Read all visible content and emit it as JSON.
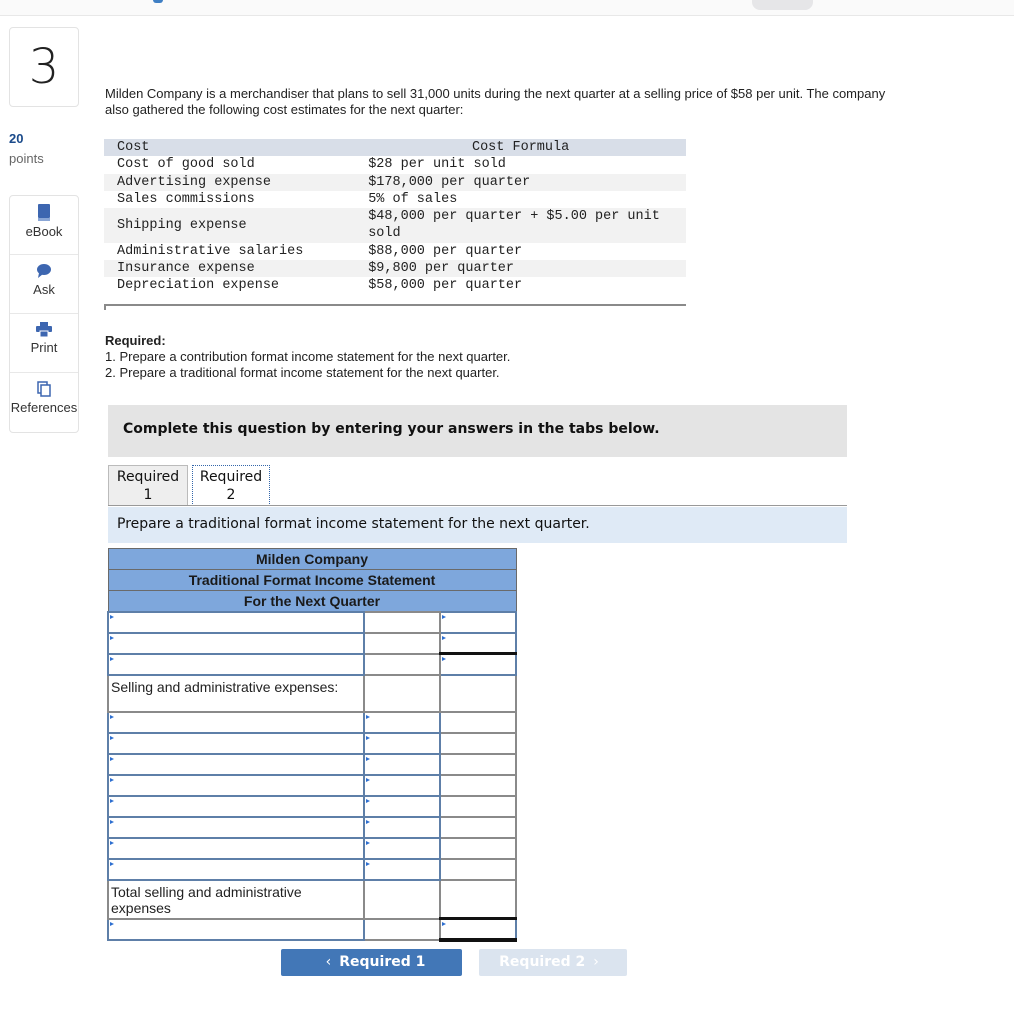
{
  "question": {
    "number": "3",
    "points_value": "20",
    "points_label": "points"
  },
  "tools": [
    {
      "label": "eBook",
      "icon": "book-icon"
    },
    {
      "label": "Ask",
      "icon": "speech-bubble-icon"
    },
    {
      "label": "Print",
      "icon": "printer-icon"
    },
    {
      "label": "References",
      "icon": "documents-icon"
    }
  ],
  "intro_text": "Milden Company is a merchandiser that plans to sell 31,000 units during the next quarter at a selling price of $58 per unit. The company also gathered the following cost estimates for the next quarter:",
  "cost_table": {
    "headers": [
      "Cost",
      "Cost Formula"
    ],
    "rows": [
      {
        "cost": "Cost of good sold",
        "formula": "$28 per unit sold"
      },
      {
        "cost": "Advertising expense",
        "formula": "$178,000 per quarter"
      },
      {
        "cost": "Sales commissions",
        "formula": "5% of sales"
      },
      {
        "cost": "Shipping expense",
        "formula": "$48,000 per quarter + $5.00 per unit sold"
      },
      {
        "cost": "Administrative salaries",
        "formula": "$88,000 per quarter"
      },
      {
        "cost": "Insurance expense",
        "formula": "$9,800 per quarter"
      },
      {
        "cost": "Depreciation expense",
        "formula": "$58,000 per quarter"
      }
    ]
  },
  "required": {
    "heading": "Required:",
    "items": [
      "1. Prepare a contribution format income statement for the next quarter.",
      "2. Prepare a traditional format income statement for the next quarter."
    ]
  },
  "instruction": "Complete this question by entering your answers in the tabs below.",
  "tabs": [
    {
      "line1": "Required",
      "line2": "1",
      "active": false
    },
    {
      "line1": "Required",
      "line2": "2",
      "active": true
    }
  ],
  "tab_prompt": "Prepare a traditional format income statement for the next quarter.",
  "statement": {
    "company": "Milden Company",
    "title": "Traditional Format Income Statement",
    "period": "For the Next Quarter",
    "selling_admin_label": "Selling and administrative expenses:",
    "total_selling_admin_label": "Total selling and administrative expenses"
  },
  "nav": {
    "prev_label": "Required 1",
    "next_label": "Required 2"
  }
}
